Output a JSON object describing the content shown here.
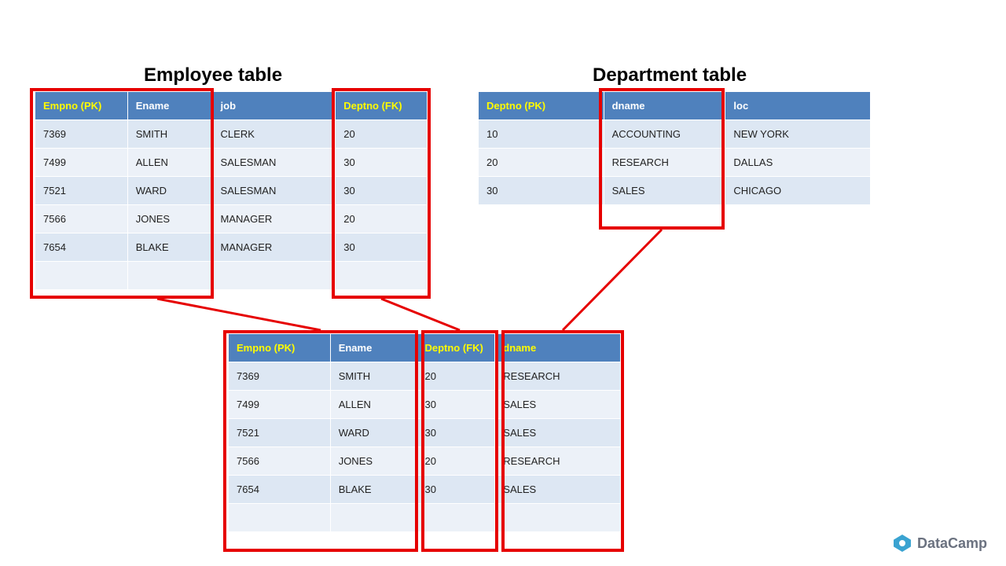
{
  "employee": {
    "title": "Employee table",
    "headers": [
      "Empno (PK)",
      "Ename",
      "job",
      "Deptno (FK)"
    ],
    "rows": [
      [
        "7369",
        "SMITH",
        "CLERK",
        "20"
      ],
      [
        "7499",
        "ALLEN",
        "SALESMAN",
        "30"
      ],
      [
        "7521",
        "WARD",
        "SALESMAN",
        "30"
      ],
      [
        "7566",
        "JONES",
        "MANAGER",
        "20"
      ],
      [
        "7654",
        "BLAKE",
        "MANAGER",
        "30"
      ]
    ]
  },
  "department": {
    "title": "Department table",
    "headers": [
      "Deptno (PK)",
      "dname",
      "loc"
    ],
    "rows": [
      [
        "10",
        "ACCOUNTING",
        "NEW YORK"
      ],
      [
        "20",
        "RESEARCH",
        "DALLAS"
      ],
      [
        "30",
        "SALES",
        "CHICAGO"
      ]
    ]
  },
  "joined": {
    "headers": [
      "Empno (PK)",
      "Ename",
      "Deptno (FK)",
      "dname"
    ],
    "rows": [
      [
        "7369",
        "SMITH",
        "20",
        "RESEARCH"
      ],
      [
        "7499",
        "ALLEN",
        "30",
        "SALES"
      ],
      [
        "7521",
        "WARD",
        "30",
        "SALES"
      ],
      [
        "7566",
        "JONES",
        "20",
        "RESEARCH"
      ],
      [
        "7654",
        "BLAKE",
        "30",
        "SALES"
      ]
    ]
  },
  "brand": "DataCamp"
}
